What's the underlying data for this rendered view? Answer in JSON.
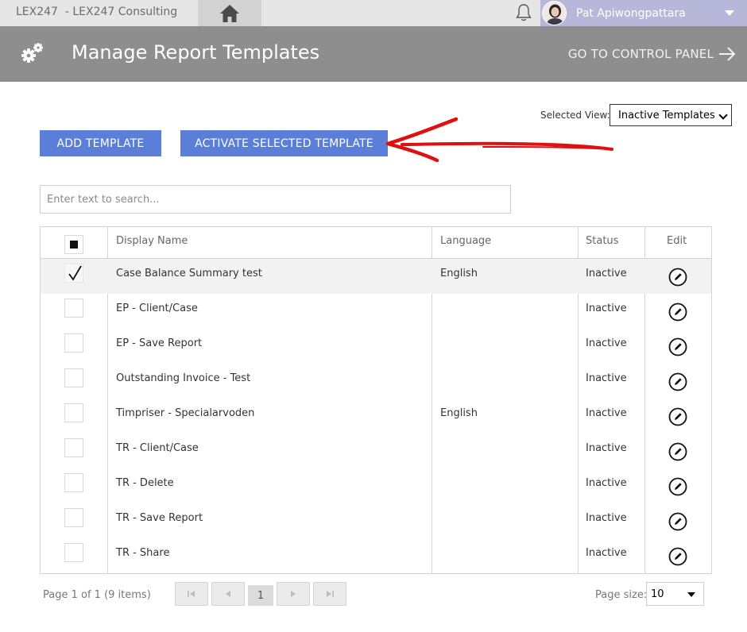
{
  "topbar": {
    "brand": "LEX247  - LEX247 Consulting",
    "user_name": "Pat Apiwongpattara",
    "icons": {
      "home": "home-icon",
      "bell": "bell-icon",
      "caret": "caret-down-icon"
    }
  },
  "header": {
    "title": "Manage Report Templates",
    "control_panel_link": "GO TO CONTROL PANEL",
    "icons": {
      "gear": "gears-icon",
      "arrow": "arrow-right-icon"
    }
  },
  "view": {
    "label": "Selected View:",
    "selected": "Inactive Templates"
  },
  "toolbar": {
    "add_label": "ADD TEMPLATE",
    "activate_label": "ACTIVATE SELECTED TEMPLATE"
  },
  "search": {
    "placeholder": "Enter text to search...",
    "value": ""
  },
  "grid": {
    "columns": {
      "name": "Display Name",
      "language": "Language",
      "status": "Status",
      "edit": "Edit"
    },
    "rows": [
      {
        "name": "Case Balance Summary test",
        "language": "English",
        "status": "Inactive",
        "checked": true
      },
      {
        "name": "EP - Client/Case",
        "language": "",
        "status": "Inactive",
        "checked": false
      },
      {
        "name": "EP - Save Report",
        "language": "",
        "status": "Inactive",
        "checked": false
      },
      {
        "name": "Outstanding Invoice - Test",
        "language": "",
        "status": "Inactive",
        "checked": false
      },
      {
        "name": "Timpriser - Specialarvoden",
        "language": "English",
        "status": "Inactive",
        "checked": false
      },
      {
        "name": "TR - Client/Case",
        "language": "",
        "status": "Inactive",
        "checked": false
      },
      {
        "name": "TR - Delete",
        "language": "",
        "status": "Inactive",
        "checked": false
      },
      {
        "name": "TR - Save Report",
        "language": "",
        "status": "Inactive",
        "checked": false
      },
      {
        "name": "TR - Share",
        "language": "",
        "status": "Inactive",
        "checked": false
      }
    ]
  },
  "pager": {
    "info": "Page 1 of 1 (9 items)",
    "current_page": "1",
    "page_size_label": "Page size:",
    "page_size": "10"
  },
  "colors": {
    "topbar": "#e6e6e6",
    "user_area": "#b7b7d9",
    "header": "#8e8e8e",
    "button": "#5b7ed8",
    "annotation_arrow": "#e01010"
  }
}
